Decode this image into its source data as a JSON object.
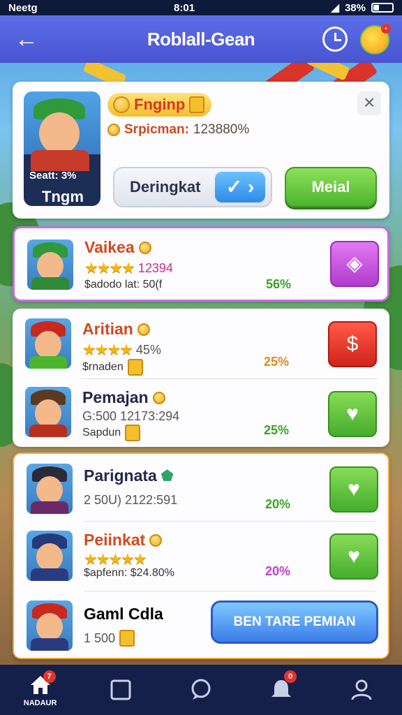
{
  "status_bar": {
    "carrier": "Neetg",
    "time": "8:01",
    "battery": "38%"
  },
  "header": {
    "title": "Roblall-Gean"
  },
  "profile": {
    "title": "Fnginp",
    "subtitle_label": "Srpicman:",
    "subtitle_value": "123880%",
    "avatar_stat": "Seatt: 3%",
    "avatar_name": "Tngm",
    "toggle_label": "Deringkat",
    "toggle_check": "✓ ›",
    "action_label": "Meial",
    "close": "×"
  },
  "list_a": [
    {
      "name": "Vaikea",
      "name_color": "#d24a1e",
      "stars": "★★★★",
      "stat": "12394",
      "stat_color": "#c2318f",
      "line3": "$adodo lat: 50(f",
      "pct": "56%",
      "pct_color": "#3aa224",
      "action_icon": "speech-bubble-icon",
      "action_glyph": "◈"
    }
  ],
  "list_b": [
    {
      "name": "Aritian",
      "name_color": "#d24a1e",
      "stars": "★★★★",
      "stat": "45%",
      "stat_color": "#555555",
      "line3": "$rnaden",
      "pct": "25%",
      "pct_color": "#e08a1a",
      "action_icon": "dollar-bubble-icon",
      "action_glyph": "$"
    },
    {
      "name": "Pemajan",
      "name_color": "#23284a",
      "stars": "",
      "stat": "G:500  12173:294",
      "stat_color": "#555555",
      "line3": "Sapdun",
      "pct": "25%",
      "pct_color": "#3aa224",
      "action_icon": "heart-bubble-icon",
      "action_glyph": "♥"
    }
  ],
  "list_c": [
    {
      "name": "Parignata",
      "name_color": "#23284a",
      "stars": "",
      "stat": "2 50U)  2122:591",
      "stat_color": "#555555",
      "line3": "",
      "pct": "20%",
      "pct_color": "#3aa224",
      "action_icon": "heart-bubble-icon",
      "action_glyph": "♥"
    },
    {
      "name": "Peiinkat",
      "name_color": "#d24a1e",
      "stars": "★★★★★",
      "stat": "",
      "stat_color": "#555555",
      "line3": "$apfenn: $24.80%",
      "pct": "20%",
      "pct_color": "#c23ccc",
      "action_icon": "heart-bubble-icon",
      "action_glyph": "♥"
    }
  ],
  "last_row": {
    "name": "Gaml Cdla",
    "stat": "1 500",
    "cta": "BEN TARE PEMIAN"
  },
  "bottom_nav": [
    {
      "label": "NADAUR",
      "icon": "home-icon",
      "badge": "7"
    },
    {
      "label": "",
      "icon": "square-icon",
      "badge": ""
    },
    {
      "label": "",
      "icon": "chat-icon",
      "badge": ""
    },
    {
      "label": "",
      "icon": "bell-icon",
      "badge": "0"
    },
    {
      "label": "",
      "icon": "profile-icon",
      "badge": ""
    }
  ],
  "colors": {
    "header": "#4a54d0",
    "accent_green": "#4bb52e",
    "accent_blue": "#3a7de8",
    "nav_bg": "#141f4a"
  }
}
